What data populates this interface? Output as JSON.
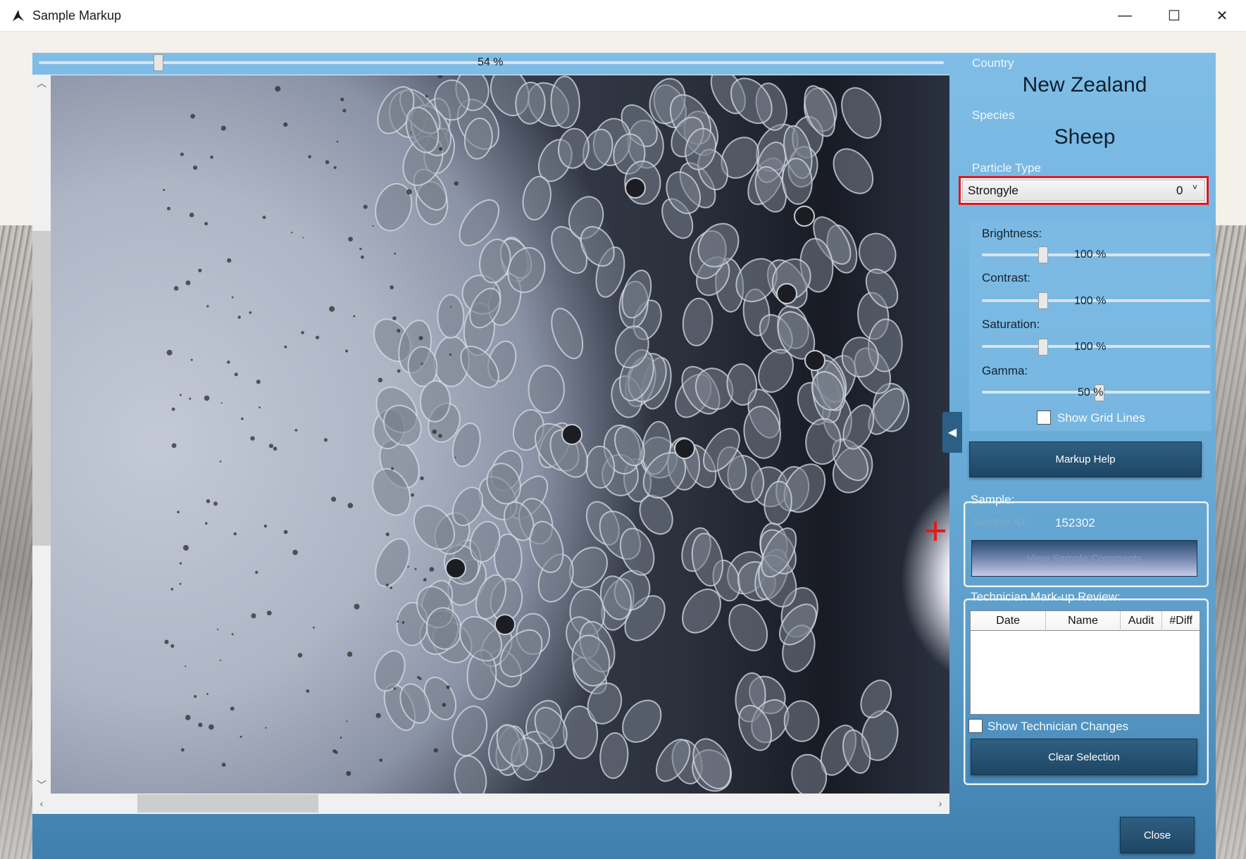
{
  "window": {
    "title": "Sample Markup",
    "minimize_glyph": "—",
    "maximize_glyph": "☐",
    "close_glyph": "✕"
  },
  "viewer": {
    "zoom_label": "54 %",
    "zoom_percent": 54,
    "scroll_up_glyph": "︿",
    "scroll_down_glyph": "﹀",
    "scroll_left_glyph": "‹",
    "scroll_right_glyph": "›",
    "collapse_glyph": "◀"
  },
  "panel": {
    "country_label": "Country",
    "country_value": "New Zealand",
    "species_label": "Species",
    "species_value": "Sheep",
    "particle_type_label": "Particle Type",
    "particle_type_value": "Strongyle",
    "particle_type_count": "0",
    "particle_chevron": "˅",
    "highlight_color": "#e3161d"
  },
  "adjustments": {
    "brightness_label": "Brightness:",
    "brightness_value": "100 %",
    "contrast_label": "Contrast:",
    "contrast_value": "100 %",
    "saturation_label": "Saturation:",
    "saturation_value": "100 %",
    "gamma_label": "Gamma:",
    "gamma_value": "50 %",
    "show_grid_label": "Show Grid Lines",
    "show_grid_checked": false
  },
  "buttons": {
    "markup_help": "Markup Help",
    "view_comments": "View Sample Comments",
    "clear_selection": "Clear Selection",
    "close": "Close"
  },
  "sample": {
    "legend": "Sample:",
    "id_label": "Sample ID :",
    "id_value": "152302"
  },
  "review": {
    "legend": "Technician Mark-up Review:",
    "columns": [
      "Date",
      "Name",
      "Audit",
      "#Diff"
    ],
    "show_changes_label": "Show Technician Changes",
    "show_changes_checked": false
  }
}
